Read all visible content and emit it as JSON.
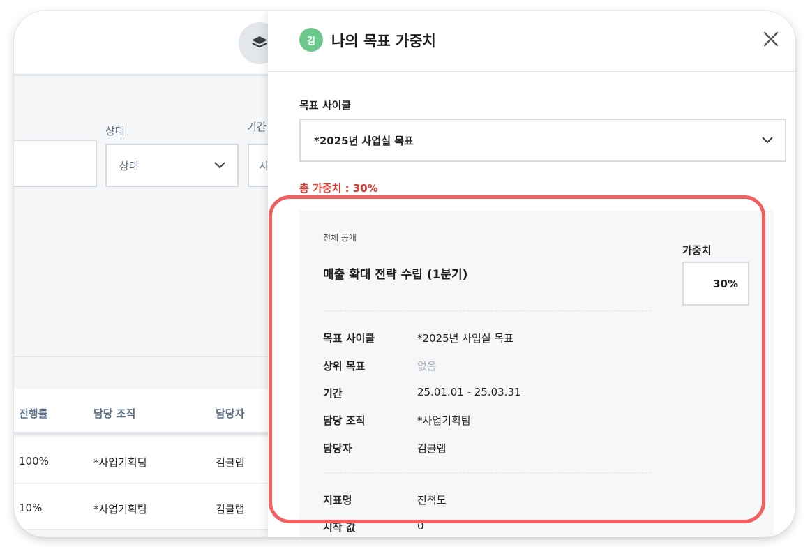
{
  "background": {
    "filters": {
      "status_label": "상태",
      "status_value": "상태",
      "period_label": "기간",
      "period_value": "시"
    },
    "table": {
      "headers": [
        "진행률",
        "담당 조직",
        "담당자"
      ],
      "rows": [
        [
          "100%",
          "*사업기획팀",
          "김클랩"
        ],
        [
          "10%",
          "*사업기획팀",
          "김클랩"
        ]
      ]
    }
  },
  "drawer": {
    "avatar_text": "김",
    "title": "나의 목표 가중치",
    "cycle_label": "목표 사이클",
    "cycle_value": "*2025년 사업실 목표",
    "total_weight": "총 가중치 : 30%",
    "card": {
      "visibility": "전체 공개",
      "goal_title": "매출 확대 전략 수립 (1분기)",
      "weight_label": "가중치",
      "weight_value": "30%",
      "details": [
        {
          "key": "목표 사이클",
          "value": "*2025년 사업실 목표",
          "muted": false
        },
        {
          "key": "상위 목표",
          "value": "없음",
          "muted": true
        },
        {
          "key": "기간",
          "value": "25.01.01 - 25.03.31",
          "muted": false
        },
        {
          "key": "담당 조직",
          "value": "*사업기획팀",
          "muted": false
        },
        {
          "key": "담당자",
          "value": "김클랩",
          "muted": false
        }
      ],
      "metrics": [
        {
          "key": "지표명",
          "value": "진척도"
        },
        {
          "key": "시작 값",
          "value": "0"
        }
      ]
    }
  },
  "colors": {
    "accent_red": "#d93a32",
    "highlight_border": "#f25f5f",
    "avatar_green": "#6cc78a"
  }
}
